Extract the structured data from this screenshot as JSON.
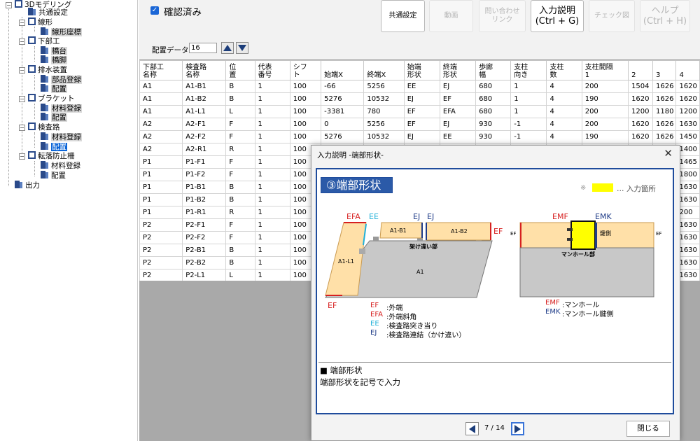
{
  "tree": {
    "items": [
      "3Dモデリング",
      "共通設定",
      "線形",
      "線形座標",
      "下部工",
      "橋台",
      "橋脚",
      "排水装置",
      "部品登録",
      "配置",
      "ブラケット",
      "材料登録",
      "配置",
      "検査路",
      "材料登録",
      "配置",
      "転落防止柵",
      "材料登録",
      "配置",
      "出力"
    ]
  },
  "toolbar": {
    "confirmed_label": "確認済み",
    "common_settings": "共通設定",
    "video": "動画",
    "inquiry_link": "問い合わせ\nリンク",
    "input_help": "入力説明\n(Ctrl + G)",
    "check_diagram": "チェック図",
    "help": "ヘルプ\n(Ctrl + H)",
    "layout_data_label": "配置データ",
    "layout_data_value": "16"
  },
  "grid": {
    "columns": [
      "下部工\n名称",
      "検査路\n名称",
      "位\n置",
      "代表\n番号",
      "シフ\nト",
      "始端X",
      "終端X",
      "始端\n形状",
      "終端\n形状",
      "歩廊\n幅",
      "支柱\n向き",
      "支柱\n数",
      "支柱間隔\n1",
      "2",
      "3",
      "4"
    ],
    "rows": [
      [
        "A1",
        "A1-B1",
        "B",
        "1",
        "100",
        "-66",
        "5256",
        "EE",
        "EJ",
        "680",
        "1",
        "4",
        "200",
        "1504",
        "1626",
        "1620"
      ],
      [
        "A1",
        "A1-B2",
        "B",
        "1",
        "100",
        "5276",
        "10532",
        "EJ",
        "EF",
        "680",
        "1",
        "4",
        "190",
        "1620",
        "1626",
        "1620"
      ],
      [
        "A1",
        "A1-L1",
        "L",
        "1",
        "100",
        "-3381",
        "780",
        "EF",
        "EFA",
        "680",
        "1",
        "4",
        "200",
        "1200",
        "1180",
        "1200"
      ],
      [
        "A2",
        "A2-F1",
        "F",
        "1",
        "100",
        "0",
        "5256",
        "EF",
        "EJ",
        "930",
        "-1",
        "4",
        "200",
        "1620",
        "1626",
        "1630"
      ],
      [
        "A2",
        "A2-F2",
        "F",
        "1",
        "100",
        "5276",
        "10532",
        "EJ",
        "EE",
        "930",
        "-1",
        "4",
        "190",
        "1620",
        "1626",
        "1450"
      ],
      [
        "A2",
        "A2-R1",
        "R",
        "1",
        "100",
        "",
        "",
        "",
        "",
        "",
        "",
        "",
        "",
        "",
        "",
        "1400"
      ],
      [
        "P1",
        "P1-F1",
        "F",
        "1",
        "100",
        "",
        "",
        "",
        "",
        "",
        "",
        "",
        "",
        "",
        "",
        "1465"
      ],
      [
        "P1",
        "P1-F2",
        "F",
        "1",
        "100",
        "",
        "",
        "",
        "",
        "",
        "",
        "",
        "",
        "",
        "",
        "1800"
      ],
      [
        "P1",
        "P1-B1",
        "B",
        "1",
        "100",
        "",
        "",
        "",
        "",
        "",
        "",
        "",
        "",
        "",
        "",
        "1630"
      ],
      [
        "P1",
        "P1-B2",
        "B",
        "1",
        "100",
        "",
        "",
        "",
        "",
        "",
        "",
        "",
        "",
        "",
        "",
        "1630"
      ],
      [
        "P1",
        "P1-R1",
        "R",
        "1",
        "100",
        "",
        "",
        "",
        "",
        "",
        "",
        "",
        "",
        "",
        "",
        "200"
      ],
      [
        "P2",
        "P2-F1",
        "F",
        "1",
        "100",
        "",
        "",
        "",
        "",
        "",
        "",
        "",
        "",
        "",
        "",
        "1630"
      ],
      [
        "P2",
        "P2-F2",
        "F",
        "1",
        "100",
        "",
        "",
        "",
        "",
        "",
        "",
        "",
        "",
        "",
        "",
        "1630"
      ],
      [
        "P2",
        "P2-B1",
        "B",
        "1",
        "100",
        "",
        "",
        "",
        "",
        "",
        "",
        "",
        "",
        "",
        "",
        "1630"
      ],
      [
        "P2",
        "P2-B2",
        "B",
        "1",
        "100",
        "",
        "",
        "",
        "",
        "",
        "",
        "",
        "",
        "",
        "",
        "1630"
      ],
      [
        "P2",
        "P2-L1",
        "L",
        "1",
        "100",
        "",
        "",
        "",
        "",
        "",
        "",
        "",
        "",
        "",
        "",
        "1630"
      ]
    ]
  },
  "dialog": {
    "title": "入力説明 -端部形状-",
    "header": "③端部形状",
    "legend_mark": "※",
    "legend_text": "… 入力箇所",
    "fig_labels": {
      "efa": "EFA",
      "ee": "EE",
      "ej1": "EJ",
      "ej2": "EJ",
      "ef_right": "EF",
      "ef_bottom": "EF",
      "a1b1": "A1-B1",
      "a1b2": "A1-B2",
      "a1l1": "A1-L1",
      "a1": "A1",
      "overlap": "架け違い部",
      "emf": "EMF",
      "emk": "EMK",
      "ef_l": "EF",
      "ef_r": "EF",
      "key_side": "鍵側",
      "manhole": "マンホール部"
    },
    "legend_left": [
      {
        "code": "EF",
        "text": ":外端"
      },
      {
        "code": "EFA",
        "text": ":外端斜角"
      },
      {
        "code": "EE",
        "text": ":検査路突き当り"
      },
      {
        "code": "EJ",
        "text": ":検査路連結（かけ違い）"
      }
    ],
    "legend_right": [
      {
        "code": "EMF",
        "text": ":マンホール"
      },
      {
        "code": "EMK",
        "text": ":マンホール鍵側"
      }
    ],
    "desc_title": "■ 端部形状",
    "desc_text": "端部形状を記号で入力",
    "page": "7 / 14",
    "close": "閉じる"
  },
  "colors": {
    "accent": "#2b5aa8",
    "highlight": "#ffff00",
    "red": "#d62020",
    "cyan": "#20b0d8"
  }
}
